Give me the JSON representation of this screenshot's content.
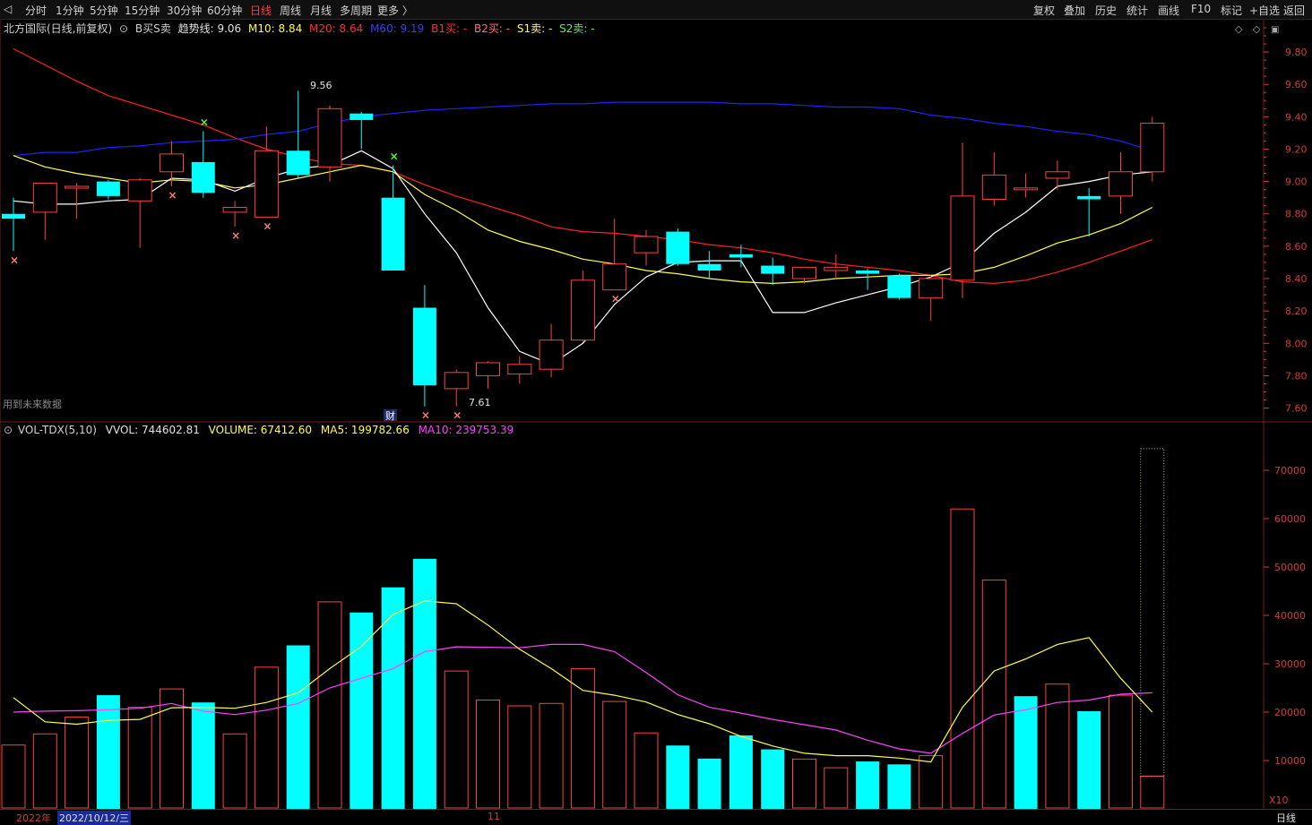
{
  "toolbar": {
    "periods": [
      "分时",
      "1分钟",
      "5分钟",
      "15分钟",
      "30分钟",
      "60分钟",
      "日线",
      "周线",
      "月线",
      "多周期",
      "更多 〉"
    ],
    "active": "日线",
    "right_buttons": [
      "复权",
      "叠加",
      "历史",
      "统计",
      "画线",
      "F10",
      "标记",
      "+自选",
      "返回"
    ]
  },
  "price_info": {
    "stock": "北方国际(日线,前复权)",
    "indicator": "B买S卖",
    "trend_label": "趋势线:",
    "trend_value": "9.06",
    "m10": "M10: 8.84",
    "m20": "M20: 8.64",
    "m60": "M60: 9.19",
    "b1": "B1买: -",
    "b2": "B2买: -",
    "s1": "S1卖: -",
    "s2": "S2卖: -"
  },
  "vol_info": {
    "name": "VOL-TDX(5,10)",
    "vvol": "VVOL: 744602.81",
    "volume": "VOLUME: 67412.60",
    "ma5": "MA5: 199782.66",
    "ma10": "MA10: 239753.39"
  },
  "notes": {
    "future_data": "用到未来数据",
    "fin_marker": "财",
    "high_label": "9.56",
    "low_label": "7.61",
    "vol_unit": "X10"
  },
  "datebar": {
    "year": "2022年",
    "cursor_date": "2022/10/12/三",
    "month_mark": "11",
    "period": "日线"
  },
  "colors": {
    "up": "#ff4040",
    "down": "#00ffff",
    "ma_white": "#ffffff",
    "ma_yellow": "#ffff40",
    "ma_red": "#ff2020",
    "ma_blue": "#2020ff",
    "vol_ma10": "#ff40ff",
    "axis": "#d23b3b"
  },
  "chart_data": [
    {
      "type": "candlestick",
      "ylim": [
        7.52,
        9.9
      ],
      "yticks": [
        "9.80",
        "9.60",
        "9.40",
        "9.20",
        "9.00",
        "8.80",
        "8.60",
        "8.40",
        "8.20",
        "8.00",
        "7.80",
        "7.60"
      ],
      "candles": [
        {
          "o": 8.8,
          "h": 8.9,
          "l": 8.57,
          "c": 8.77
        },
        {
          "o": 8.81,
          "h": 8.99,
          "l": 8.64,
          "c": 8.99
        },
        {
          "o": 8.97,
          "h": 8.99,
          "l": 8.77,
          "c": 8.97
        },
        {
          "o": 9.0,
          "h": 9.01,
          "l": 8.89,
          "c": 8.91
        },
        {
          "o": 8.88,
          "h": 9.02,
          "l": 8.59,
          "c": 9.01
        },
        {
          "o": 9.06,
          "h": 9.25,
          "l": 8.97,
          "c": 9.17
        },
        {
          "o": 9.12,
          "h": 9.31,
          "l": 8.9,
          "c": 8.93
        },
        {
          "o": 8.81,
          "h": 8.88,
          "l": 8.72,
          "c": 8.84
        },
        {
          "o": 8.78,
          "h": 9.34,
          "l": 8.78,
          "c": 9.19
        },
        {
          "o": 9.19,
          "h": 9.56,
          "l": 9.02,
          "c": 9.04
        },
        {
          "o": 9.09,
          "h": 9.47,
          "l": 9.0,
          "c": 9.45
        },
        {
          "o": 9.42,
          "h": 9.43,
          "l": 9.2,
          "c": 9.38
        },
        {
          "o": 8.9,
          "h": 9.1,
          "l": 8.45,
          "c": 8.45
        },
        {
          "o": 8.22,
          "h": 8.36,
          "l": 7.61,
          "c": 7.74
        },
        {
          "o": 7.72,
          "h": 7.84,
          "l": 7.61,
          "c": 7.82
        },
        {
          "o": 7.8,
          "h": 7.89,
          "l": 7.72,
          "c": 7.88
        },
        {
          "o": 7.81,
          "h": 7.92,
          "l": 7.75,
          "c": 7.87
        },
        {
          "o": 7.84,
          "h": 8.12,
          "l": 7.79,
          "c": 8.02
        },
        {
          "o": 8.02,
          "h": 8.45,
          "l": 8.01,
          "c": 8.39
        },
        {
          "o": 8.33,
          "h": 8.77,
          "l": 8.33,
          "c": 8.49
        },
        {
          "o": 8.56,
          "h": 8.7,
          "l": 8.48,
          "c": 8.66
        },
        {
          "o": 8.69,
          "h": 8.71,
          "l": 8.48,
          "c": 8.49
        },
        {
          "o": 8.49,
          "h": 8.57,
          "l": 8.4,
          "c": 8.45
        },
        {
          "o": 8.55,
          "h": 8.61,
          "l": 8.47,
          "c": 8.53
        },
        {
          "o": 8.48,
          "h": 8.53,
          "l": 8.36,
          "c": 8.43
        },
        {
          "o": 8.4,
          "h": 8.47,
          "l": 8.37,
          "c": 8.47
        },
        {
          "o": 8.45,
          "h": 8.55,
          "l": 8.4,
          "c": 8.47
        },
        {
          "o": 8.45,
          "h": 8.46,
          "l": 8.33,
          "c": 8.43
        },
        {
          "o": 8.42,
          "h": 8.43,
          "l": 8.27,
          "c": 8.28
        },
        {
          "o": 8.28,
          "h": 8.42,
          "l": 8.14,
          "c": 8.4
        },
        {
          "o": 8.39,
          "h": 9.24,
          "l": 8.28,
          "c": 8.91
        },
        {
          "o": 8.89,
          "h": 9.18,
          "l": 8.85,
          "c": 9.04
        },
        {
          "o": 8.95,
          "h": 9.05,
          "l": 8.9,
          "c": 8.96
        },
        {
          "o": 9.02,
          "h": 9.13,
          "l": 8.95,
          "c": 9.06
        },
        {
          "o": 8.91,
          "h": 8.96,
          "l": 8.66,
          "c": 8.89
        },
        {
          "o": 8.91,
          "h": 9.18,
          "l": 8.8,
          "c": 9.06
        },
        {
          "o": 9.06,
          "h": 9.4,
          "l": 9.0,
          "c": 9.36
        }
      ],
      "ma_trend": [
        8.88,
        8.86,
        8.86,
        8.88,
        8.89,
        9.02,
        9.01,
        8.94,
        9.02,
        9.08,
        9.1,
        9.19,
        9.08,
        8.8,
        8.56,
        8.22,
        7.95,
        7.87,
        8.0,
        8.24,
        8.41,
        8.5,
        8.51,
        8.51,
        8.19,
        8.19,
        8.25,
        8.3,
        8.35,
        8.41,
        8.5,
        8.68,
        8.81,
        8.97,
        9.0,
        9.04,
        9.06
      ],
      "ma10": [
        9.16,
        9.09,
        9.05,
        9.02,
        8.99,
        9.01,
        9.0,
        8.96,
        8.98,
        9.02,
        9.06,
        9.1,
        9.06,
        8.92,
        8.82,
        8.7,
        8.63,
        8.58,
        8.52,
        8.49,
        8.45,
        8.43,
        8.4,
        8.38,
        8.37,
        8.38,
        8.4,
        8.41,
        8.42,
        8.42,
        8.43,
        8.47,
        8.54,
        8.62,
        8.67,
        8.74,
        8.84
      ],
      "ma20": [
        9.82,
        9.72,
        9.62,
        9.53,
        9.47,
        9.41,
        9.35,
        9.27,
        9.2,
        9.15,
        9.11,
        9.1,
        9.06,
        8.98,
        8.91,
        8.85,
        8.79,
        8.72,
        8.69,
        8.68,
        8.66,
        8.64,
        8.61,
        8.59,
        8.56,
        8.52,
        8.49,
        8.47,
        8.45,
        8.42,
        8.38,
        8.37,
        8.39,
        8.44,
        8.5,
        8.57,
        8.64
      ],
      "ma60": [
        9.16,
        9.18,
        9.18,
        9.21,
        9.22,
        9.24,
        9.25,
        9.26,
        9.29,
        9.31,
        9.36,
        9.4,
        9.42,
        9.44,
        9.45,
        9.46,
        9.47,
        9.48,
        9.48,
        9.49,
        9.49,
        9.49,
        9.49,
        9.48,
        9.48,
        9.47,
        9.46,
        9.46,
        9.45,
        9.41,
        9.39,
        9.36,
        9.34,
        9.31,
        9.29,
        9.25,
        9.19
      ],
      "buy_marks": [
        6,
        12
      ],
      "sell_marks": [
        0,
        5,
        7,
        8,
        13,
        14,
        19
      ]
    },
    {
      "type": "bar",
      "ylim": [
        0,
        75000
      ],
      "yticks": [
        "70000",
        "60000",
        "50000",
        "40000",
        "30000",
        "20000",
        "10000"
      ],
      "values": [
        13200,
        15500,
        19000,
        23500,
        21000,
        24800,
        22000,
        15500,
        29300,
        33800,
        42800,
        40600,
        45800,
        51700,
        28500,
        22500,
        21300,
        21800,
        29000,
        22200,
        15700,
        13100,
        10400,
        15200,
        12300,
        10300,
        8500,
        9800,
        9200,
        11000,
        62000,
        47300,
        23300,
        25800,
        20200,
        23500,
        6741
      ],
      "up": [
        1,
        1,
        1,
        0,
        1,
        1,
        0,
        1,
        1,
        0,
        1,
        0,
        0,
        0,
        1,
        1,
        1,
        1,
        1,
        1,
        1,
        0,
        0,
        0,
        0,
        1,
        1,
        0,
        0,
        1,
        1,
        1,
        0,
        1,
        0,
        1,
        1
      ],
      "ma5": [
        23000,
        18000,
        17500,
        18300,
        18500,
        20900,
        21000,
        20800,
        22000,
        24000,
        29000,
        33600,
        40200,
        43000,
        42400,
        38000,
        33000,
        29000,
        24500,
        23500,
        22100,
        19500,
        17600,
        15000,
        13000,
        11500,
        11000,
        11000,
        10500,
        9700,
        21000,
        28500,
        31000,
        34000,
        35400,
        27000,
        20000
      ],
      "ma10": [
        20000,
        20200,
        20300,
        20500,
        20800,
        21800,
        20200,
        19500,
        20400,
        21800,
        25000,
        27000,
        29000,
        32500,
        33500,
        33400,
        33300,
        34000,
        34000,
        32500,
        28200,
        23600,
        21000,
        19800,
        18500,
        17400,
        16300,
        14200,
        12400,
        11500,
        15600,
        19400,
        20500,
        22000,
        22500,
        23700,
        24000
      ],
      "ghost_top": 74460
    }
  ]
}
